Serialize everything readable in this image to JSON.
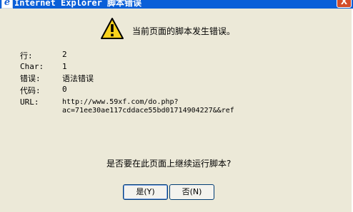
{
  "window": {
    "icon_glyph": "e",
    "title": "Internet Explorer 脚本错误",
    "close_glyph": "X"
  },
  "message": {
    "icon": "warning-icon",
    "headline": "当前页面的脚本发生错误。"
  },
  "details": [
    {
      "label": "行:",
      "value": "2"
    },
    {
      "label": "Char:",
      "value": "1"
    },
    {
      "label": "错误:",
      "value": "语法错误"
    },
    {
      "label": "代码:",
      "value": "0"
    },
    {
      "label": "URL:",
      "value": "http://www.59xf.com/do.php?",
      "value2": "ac=71ee30ae117cddace55bd01714904227&&ref"
    }
  ],
  "prompt": {
    "question": "是否要在此页面上继续运行脚本?"
  },
  "buttons": {
    "yes_label": "是(Y)",
    "no_label": "否(N)"
  },
  "colors": {
    "titlebar": "#0a5fd8",
    "dialog_bg": "#ece9d8",
    "close_button": "#d34d2a",
    "warning_yellow": "#f8d21c"
  }
}
